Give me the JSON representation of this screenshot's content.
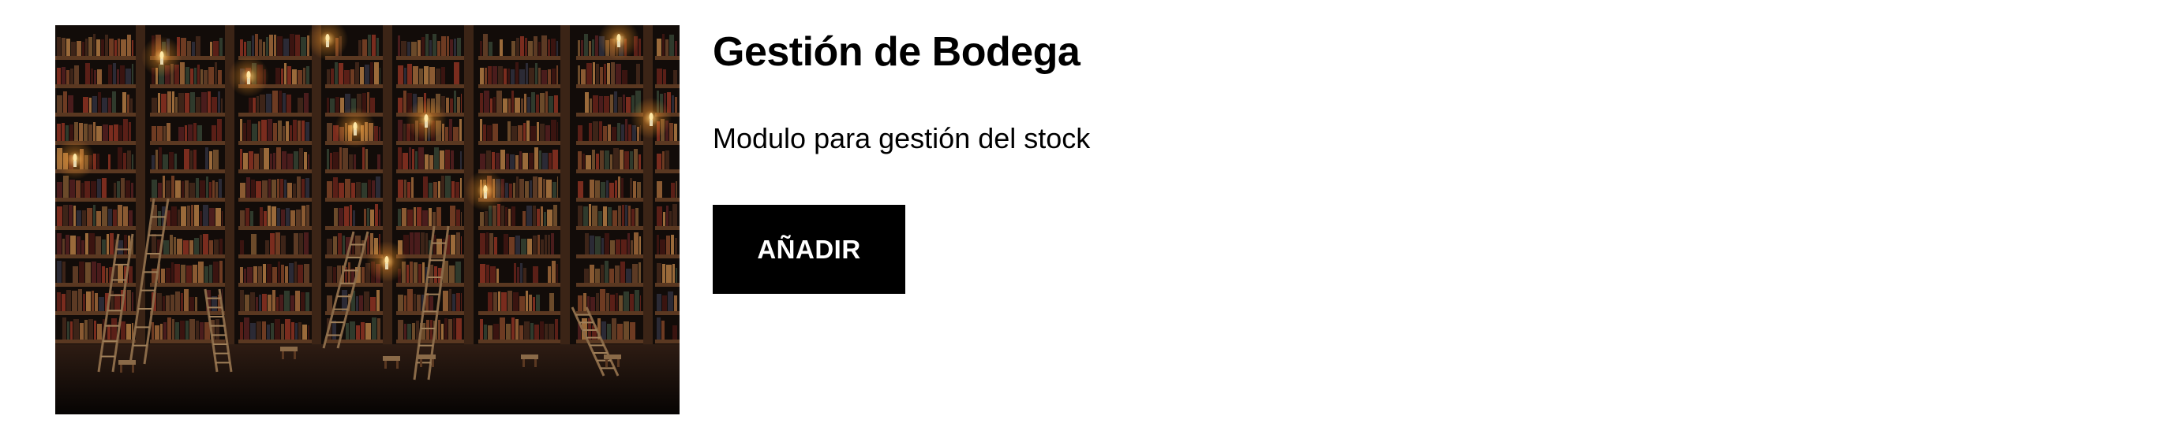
{
  "module": {
    "title": "Gestión de Bodega",
    "description": "Modulo para gestión del stock",
    "add_button_label": "AÑADIR",
    "image": {
      "subject": "library-bookshelves-with-ladders-and-candles",
      "colors": {
        "background": "#120c09",
        "wood": "#4a2e1c",
        "candle_glow": "#ffcf6b",
        "floor": "#2a1a12"
      }
    }
  },
  "theme": {
    "button_background": "#000000",
    "button_text": "#ffffff",
    "text": "#000000",
    "page_background": "#ffffff"
  }
}
